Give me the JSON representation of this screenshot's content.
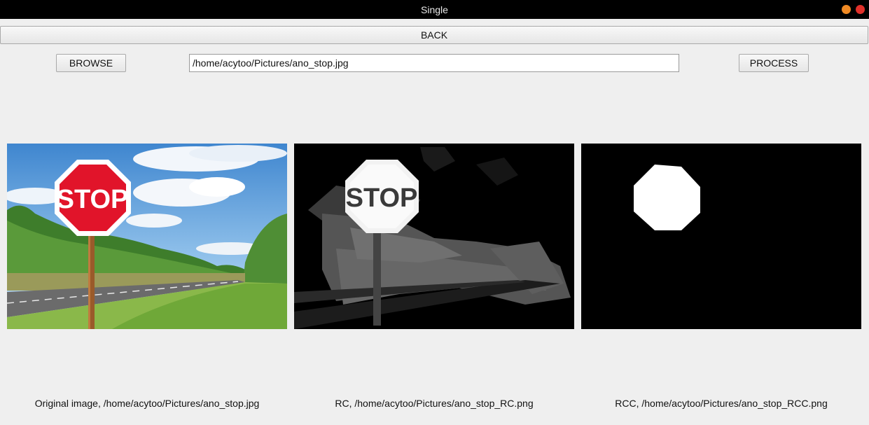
{
  "window": {
    "title": "Single",
    "controls": [
      {
        "name": "minimize",
        "color": "#f08a24"
      },
      {
        "name": "close",
        "color": "#e0302a"
      }
    ]
  },
  "toolbar": {
    "back_label": "BACK",
    "browse_label": "BROWSE",
    "path_value": "/home/acytoo/Pictures/ano_stop.jpg",
    "process_label": "PROCESS"
  },
  "images": {
    "original": {
      "sign_text": "STOP",
      "caption": "Original image, /home/acytoo/Pictures/ano_stop.jpg"
    },
    "rc": {
      "sign_text": "STOP",
      "caption": "RC, /home/acytoo/Pictures/ano_stop_RC.png"
    },
    "rcc": {
      "caption": "RCC, /home/acytoo/Pictures/ano_stop_RCC.png"
    }
  }
}
